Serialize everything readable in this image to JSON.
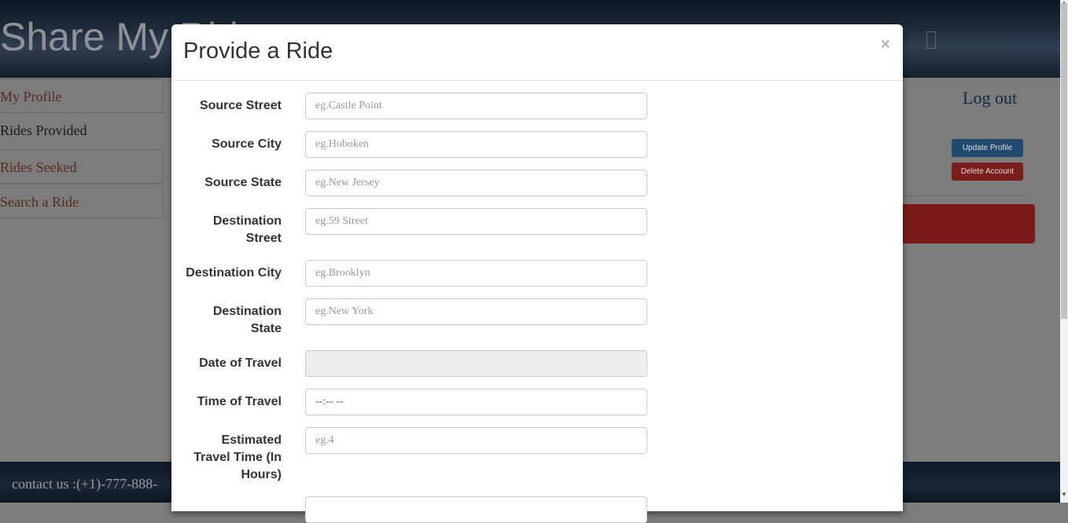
{
  "header": {
    "brand": "Share My Ride"
  },
  "sidebar": {
    "items": [
      {
        "label": "My Profile"
      },
      {
        "label": "Rides Provided"
      },
      {
        "label": "Rides Seeked"
      },
      {
        "label": "Search a Ride"
      }
    ]
  },
  "account": {
    "logout": "Log out",
    "update_profile": "Update Profile",
    "delete_account": "Delete Account"
  },
  "footer": {
    "contact": "contact us :(+1)-777-888-"
  },
  "modal": {
    "title": "Provide a Ride",
    "close": "×",
    "fields": [
      {
        "label": "Source Street",
        "placeholder": "eg.Castle Point",
        "value": ""
      },
      {
        "label": "Source City",
        "placeholder": "eg.Hoboken",
        "value": ""
      },
      {
        "label": "Source State",
        "placeholder": "eg.New Jersey",
        "value": ""
      },
      {
        "label": "Destination Street",
        "placeholder": "eg.59 Street",
        "value": ""
      },
      {
        "label": "Destination City",
        "placeholder": "eg.Brooklyn",
        "value": ""
      },
      {
        "label": "Destination State",
        "placeholder": "eg.New York",
        "value": ""
      },
      {
        "label": "Date of Travel",
        "placeholder": "",
        "value": ""
      },
      {
        "label": "Time of Travel",
        "placeholder": "",
        "value": "--:-- --"
      },
      {
        "label": "Estimated Travel Time (In Hours)",
        "placeholder": "eg.4",
        "value": ""
      }
    ]
  },
  "colors": {
    "primary": "#214970",
    "danger": "#7a1d1c",
    "link": "#5a2a20"
  },
  "icons": {
    "close": "close-icon"
  }
}
